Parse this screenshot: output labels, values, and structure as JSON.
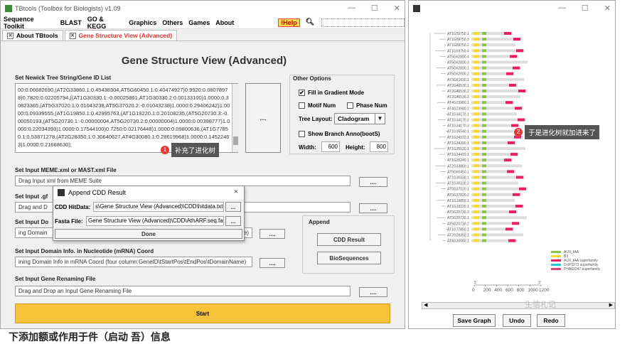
{
  "left_window": {
    "title": "TBtools (Toolbox for Biologists) v1.09",
    "menu": [
      "Sequence Toolkit",
      "BLAST",
      "GO & KEGG",
      "Graphics",
      "Others",
      "Games",
      "About"
    ],
    "help_label": "!Help",
    "tabs": [
      {
        "label": "About TBtools",
        "active": false
      },
      {
        "label": "Gene Structure View (Advanced)",
        "active": true
      }
    ],
    "page_title": "Gene Structure View (Advanced)",
    "newick_section": {
      "label": "Set Newick Tree String/Gene ID List",
      "lines": [
        "00:0.06682690,(AT2G33860.1:0.45438304,AT5G60450.1:0.40474927)0.9920:0.0807897",
        "8)0.7820:0.02205794,((AT1G30330.1:-0.00025861,AT1G30330.2:0.00133100)1.0000:0.3",
        "0823365,(AT5G37020.1:0.01043238,AT5G37020.2:-0.01043238)1.0000:0.29406242)1.00",
        "00:0.09339555,(AT1G19850.1:0.42995763,(AT1G19220.1:0.20108235,(AT5G20730.3:-0.",
        "00050193,(AT5G20730.1:-0.00000004,AT5G20730.2:0.00000004)1.0000:0.00398777)1.0",
        "000:0.22034393)1.0000:0.17544100)0.7250:0.02176448)1.0000:0.09800636,(AT1G7785",
        "0.1:0.53871278,(AT2G28350.1:0.30640627,AT4G30080.1:0.28619968)1.0000:0.1452246",
        "3)1.0000:0.21668630);"
      ],
      "browse_label": "...."
    },
    "other_options": {
      "label": "Other Options",
      "fill_gradient": {
        "label": "Fill in Gradient Mode",
        "checked": true
      },
      "motif_num": {
        "label": "Motif Num",
        "checked": false
      },
      "phase_num": {
        "label": "Phase Num",
        "checked": false
      },
      "tree_layout_label": "Tree Layout:",
      "tree_layout_value": "Cladogram",
      "show_branch": {
        "label": "Show Branch Anno(bootS)",
        "checked": false
      },
      "width_label": "Width:",
      "width_value": "600",
      "height_label": "Height:",
      "height_value": "800"
    },
    "meme_section": {
      "label": "Set Input MEME.xml or MAST.xml File",
      "placeholder": "Drag Input xml from MEME Suite",
      "btn": "...."
    },
    "gff_section": {
      "label": "Set Input .gf",
      "value": "Drag and D",
      "btn": "...."
    },
    "domain_section": {
      "label": "Set Input Do",
      "value": "ing Domain",
      "value_tail": "me)",
      "btn": "...."
    },
    "append": {
      "label": "Append",
      "cdd_btn": "CDD Result",
      "bio_btn": "BioSequences"
    },
    "mrna_section": {
      "label": "Set Input Domain Info. in Nucleotide (mRNA) Coord",
      "value": "ining Domain Info in mRNA Coord (four column:GeneID\\tStartPos\\tEndPos\\tDomainName)",
      "btn": "...."
    },
    "rename_section": {
      "label": "Set Input Gene Renaming File",
      "value": "Drag and Drop an Input Gene Renaming File",
      "btn": "...."
    },
    "start_label": "Start",
    "dialog": {
      "title": "Append CDD Result",
      "close": "×",
      "hitdata_label": "CDD HitData:",
      "hitdata_value": "s\\Gene Structure View (Advanced)\\CDD\\hitdata.txt",
      "fasta_label": "Fasta File:",
      "fasta_value": "Gene Structure View (Advanced)\\CDD\\AthARF.seq.fa",
      "browse": "...",
      "done": "Done"
    },
    "callout1": {
      "number": "1",
      "text": "补充了进化树"
    }
  },
  "right_window": {
    "genes": [
      "AT1G59750.1",
      "AT1G59750.3",
      "AT1G59750.2",
      "AT1G59750.4",
      "AT5G62000.4",
      "AT5G62000.3",
      "AT5G62000.1",
      "AT5G62000.2",
      "AT3G61830.1",
      "AT2G46530.1",
      "AT2G46530.2",
      "AT2G46530.3",
      "AT4G23980.1",
      "AT4G23980.2",
      "AT1G34170.1",
      "AT1G34170.2",
      "AT1G34170.3",
      "AT1G35540.1",
      "AT1G34310.1",
      "AT1G34390.1",
      "AT1G35520.1",
      "AT1G34410.1",
      "AT1G35240.1",
      "AT2G33860.1",
      "AT5G60450.1",
      "AT1G30330.1",
      "AT1G30330.2",
      "AT5G37020.1",
      "AT5G37020.2",
      "AT1G19850.1",
      "AT1G19220.1",
      "AT5G20730.3",
      "AT5G20730.1",
      "AT5G20730.2",
      "AT1G77850.1",
      "AT2G28350.1",
      "AT4G30080.1"
    ],
    "legend": [
      {
        "label": "AUX_IAA",
        "color": "#8bc34a"
      },
      {
        "label": "B3",
        "color": "#fdd835"
      },
      {
        "label": "AUX_IAA superfamily",
        "color": "#e91e63"
      },
      {
        "label": "DUF3273 superfamily",
        "color": "#26c6da"
      },
      {
        "label": "PHA03247 superfamily",
        "color": "#ec407a"
      }
    ],
    "axis_ticks": [
      "0",
      "200",
      "400",
      "600",
      "800",
      "1000",
      "1200"
    ],
    "axis_ends": [
      "5'",
      "3'"
    ],
    "buttons": [
      "Save Graph",
      "Undo",
      "Redo"
    ],
    "callout2": {
      "number": "2",
      "text": "于是进化树就加进来了"
    }
  },
  "watermark": "生信札记",
  "bottom_caption": "下添加额或作用于件（启动 吾）信息"
}
